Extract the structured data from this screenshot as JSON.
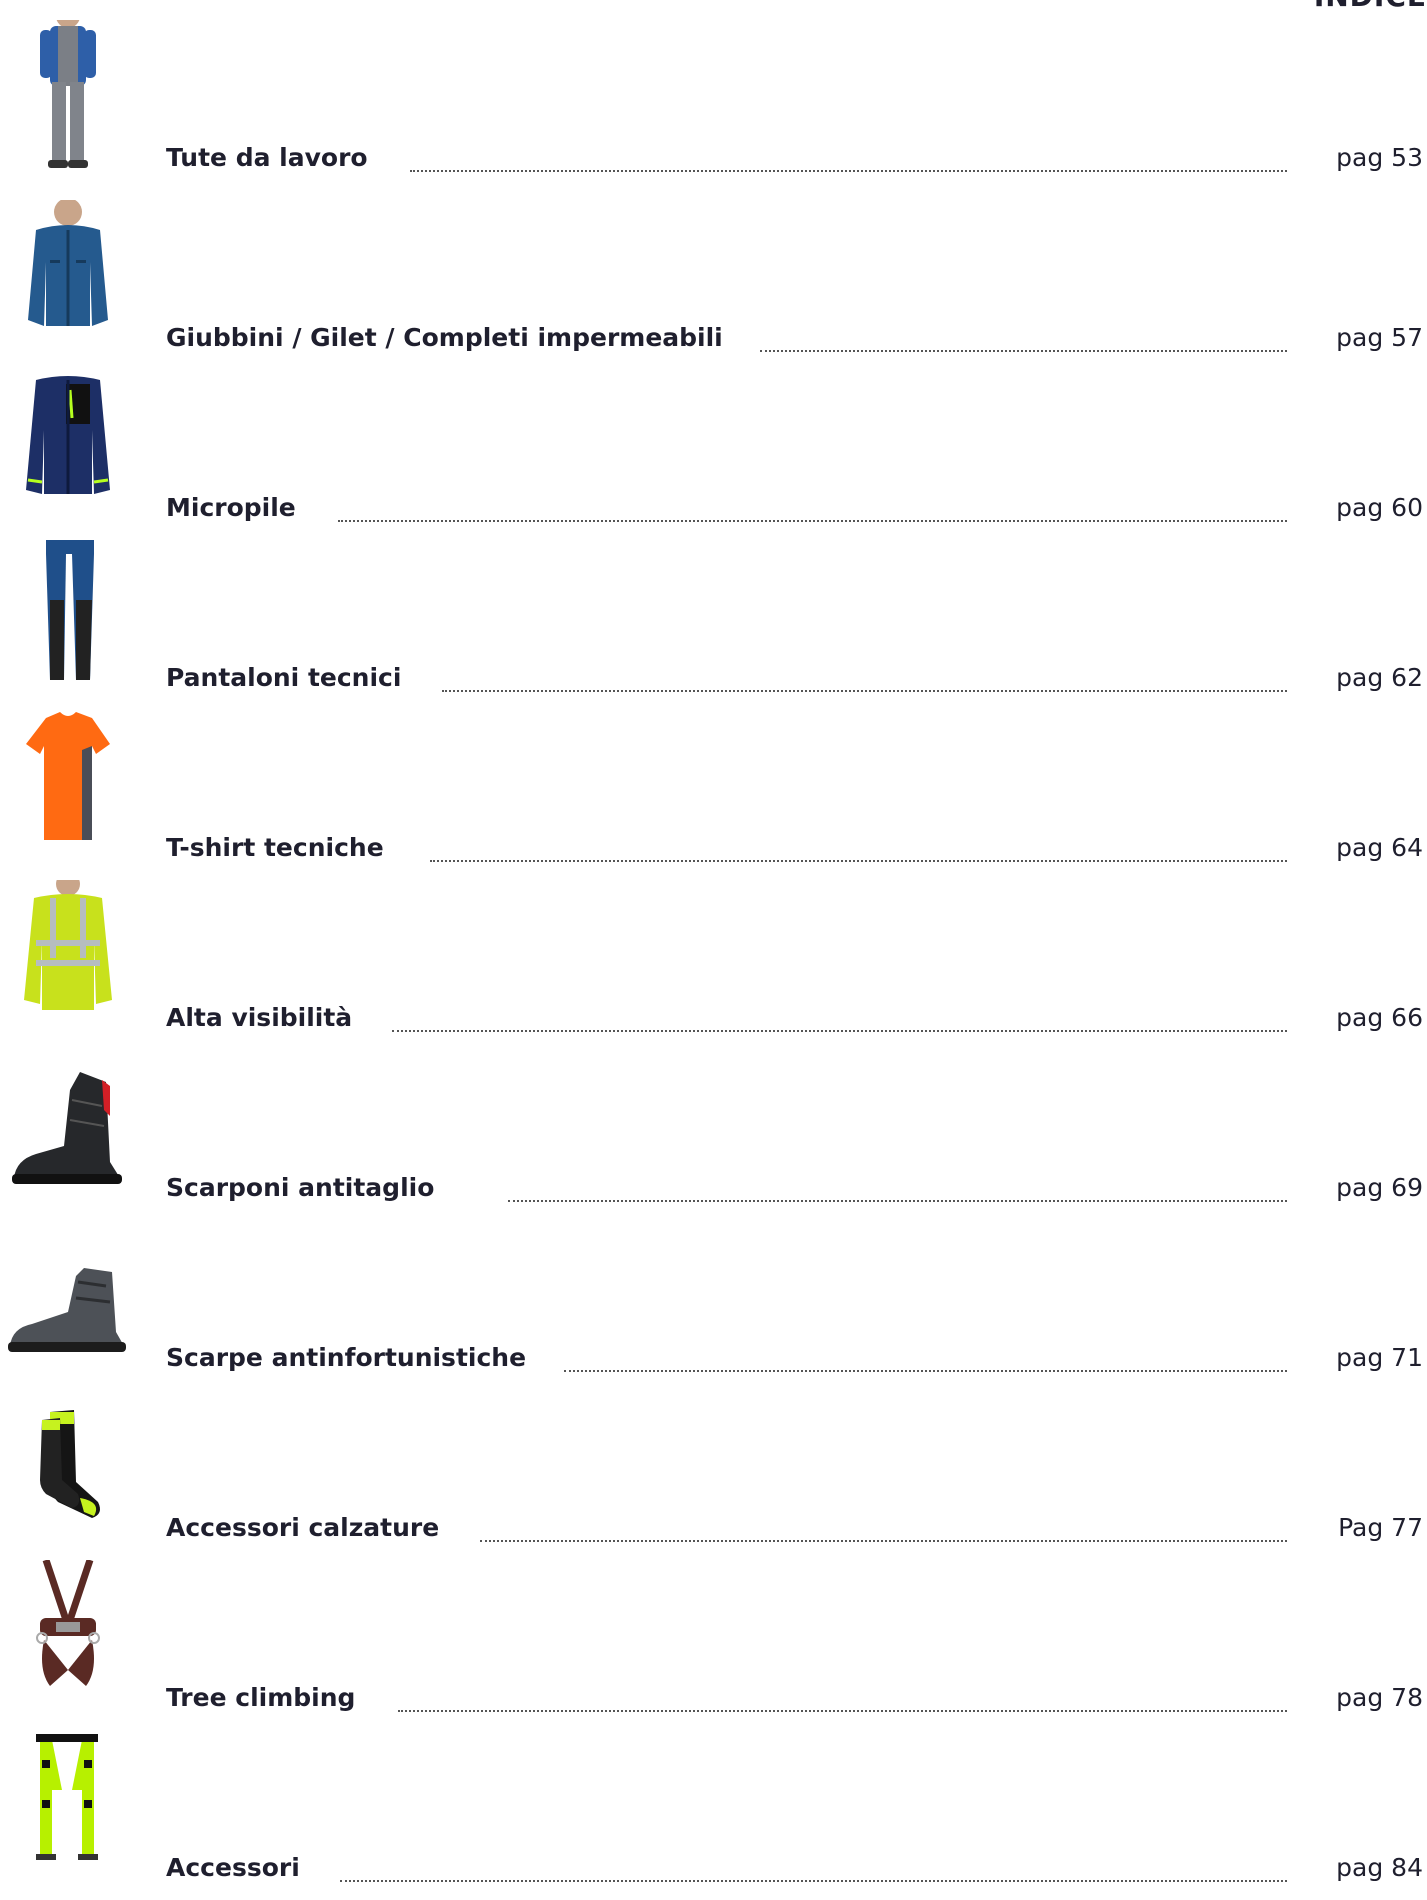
{
  "title": "INDICE",
  "entries": [
    {
      "label": "Tute da lavoro",
      "page": "pag 53",
      "icon": "coverall-icon"
    },
    {
      "label": "Giubbini / Gilet / Completi impermeabili",
      "page": "pag 57",
      "icon": "jacket-icon"
    },
    {
      "label": "Micropile",
      "page": "pag 60",
      "icon": "fleece-jacket-icon"
    },
    {
      "label": "Pantaloni tecnici",
      "page": "pag 62",
      "icon": "trousers-icon"
    },
    {
      "label": "T-shirt tecniche",
      "page": "pag 64",
      "icon": "tshirt-icon"
    },
    {
      "label": "Alta visibilità",
      "page": "pag 66",
      "icon": "hi-vis-jacket-icon"
    },
    {
      "label": "Scarponi antitaglio",
      "page": "pag 69",
      "icon": "chainsaw-boot-icon"
    },
    {
      "label": "Scarpe antinfortunistiche",
      "page": "pag 71",
      "icon": "safety-shoe-icon"
    },
    {
      "label": "Accessori calzature",
      "page": "Pag 77",
      "icon": "socks-icon"
    },
    {
      "label": "Tree climbing",
      "page": "pag 78",
      "icon": "climbing-harness-icon"
    },
    {
      "label": "Accessori",
      "page": "pag 84",
      "icon": "suspenders-icon"
    }
  ]
}
